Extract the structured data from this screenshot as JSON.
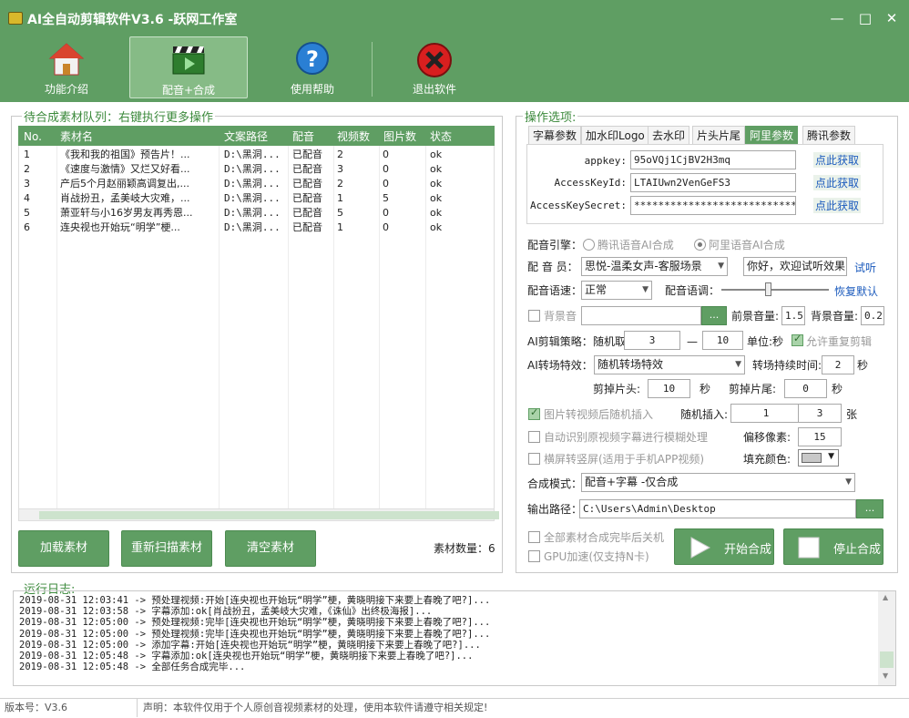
{
  "window": {
    "title": "AI全自动剪辑软件V3.6 -跃网工作室",
    "minimize": "—",
    "maximize": "□",
    "close": "✕"
  },
  "toolbar": [
    {
      "label": "功能介绍",
      "icon": "home-icon"
    },
    {
      "label": "配音+合成",
      "icon": "clapperboard-icon"
    },
    {
      "label": "使用帮助",
      "icon": "help-icon"
    },
    {
      "label": "退出软件",
      "icon": "exit-icon"
    }
  ],
  "queue": {
    "title": "待合成素材队列：右键执行更多操作",
    "columns": [
      "No.",
      "素材名",
      "文案路径",
      "配音",
      "视频数",
      "图片数",
      "状态"
    ],
    "rows": [
      [
        "1",
        "《我和我的祖国》预告片！...",
        "D:\\黑洞...",
        "已配音",
        "2",
        "0",
        "ok"
      ],
      [
        "2",
        "《速度与激情》又烂又好看...",
        "D:\\黑洞...",
        "已配音",
        "3",
        "0",
        "ok"
      ],
      [
        "3",
        "产后5个月赵丽颖高调复出,...",
        "D:\\黑洞...",
        "已配音",
        "2",
        "0",
        "ok"
      ],
      [
        "4",
        "肖战扮丑，孟美岐大灾难，...",
        "D:\\黑洞...",
        "已配音",
        "1",
        "5",
        "ok"
      ],
      [
        "5",
        "萧亚轩与小16岁男友再秀恩...",
        "D:\\黑洞...",
        "已配音",
        "5",
        "0",
        "ok"
      ],
      [
        "6",
        "连央视也开始玩“明学”梗...",
        "D:\\黑洞...",
        "已配音",
        "1",
        "0",
        "ok"
      ]
    ],
    "buttons": {
      "load": "加载素材",
      "rescan": "重新扫描素材",
      "clear": "清空素材"
    },
    "count_label": "素材数量：6"
  },
  "options": {
    "title": "操作选项:",
    "tabs": [
      "字幕参数",
      "加水印Logo",
      "去水印",
      "片头片尾",
      "阿里参数",
      "腾讯参数"
    ],
    "aliyun": {
      "appkey_label": "appkey:",
      "appkey_value": "95oVQj1CjBV2H3mq",
      "appkey_link": "点此获取",
      "akid_label": "AccessKeyId:",
      "akid_value": "LTAIUwn2VenGeFS3",
      "akid_link": "点此获取",
      "aksecret_label": "AccessKeySecret:",
      "aksecret_value": "******************************",
      "aksecret_link": "点此获取"
    },
    "engine_label": "配音引擎：",
    "engine_tencent": "腾讯语音AI合成",
    "engine_ali": "阿里语音AI合成",
    "voice_label": "配 音 员：",
    "voice_value": "思悦-温柔女声-客服场景",
    "voice_text": "你好，欢迎试听效果",
    "voice_try": "试听",
    "speed_label": "配音语速：",
    "speed_value": "正常",
    "pitch_label": "配音语调：",
    "pitch_reset": "恢复默认",
    "bgm_label": "背景音",
    "bgm_browse": "...",
    "fg_vol_label": "前景音量:",
    "fg_vol": "1.5",
    "bg_vol_label": "背景音量:",
    "bg_vol": "0.2",
    "strategy_label": "AI剪辑策略：",
    "random_label": "随机取:",
    "random_min": "3",
    "dash": "—",
    "random_max": "10",
    "unit_label": "单位:秒",
    "allow_repeat": "允许重复剪辑",
    "transition_label": "AI转场特效：",
    "transition_value": "随机转场特效",
    "transition_dur_label": "转场持续时间:",
    "transition_dur": "2",
    "sec": "秒",
    "cut_head_label": "剪掉片头:",
    "cut_head": "10",
    "cut_tail_label": "剪掉片尾:",
    "cut_tail": "0",
    "img_insert_label": "图片转视频后随机插入",
    "random_insert_label": "随机插入:",
    "insert_min": "1",
    "insert_max": "3",
    "zhang": "张",
    "blur_label": "自动识别原视频字幕进行模糊处理",
    "offset_label": "偏移像素:",
    "offset": "15",
    "portrait_label": "横屏转竖屏(适用于手机APP视频)",
    "fill_label": "填充颜色:",
    "mode_label": "合成模式：",
    "mode_value": "配音+字幕 -仅合成",
    "output_label": "输出路径：",
    "output_value": "C:\\Users\\Admin\\Desktop",
    "output_browse": "...",
    "shutdown_label": "全部素材合成完毕后关机",
    "gpu_label": "GPU加速(仅支持N卡)",
    "start": "开始合成",
    "stop": "停止合成"
  },
  "log": {
    "title": "运行日志:",
    "lines": [
      "2019-08-31 12:03:41 -> 预处理视频:开始[连央视也开始玩“明学”梗，黄晓明接下来要上春晚了吧?]...",
      "2019-08-31 12:03:58 -> 字幕添加:ok[肖战扮丑，孟美岐大灾难，《诛仙》出终极海报]...",
      "2019-08-31 12:05:00 -> 预处理视频:完毕[连央视也开始玩“明学”梗，黄晓明接下来要上春晚了吧?]...",
      "2019-08-31 12:05:00 -> 预处理视频:完毕[连央视也开始玩“明学”梗，黄晓明接下来要上春晚了吧?]...",
      "2019-08-31 12:05:00 -> 添加字幕:开始[连央视也开始玩“明学”梗，黄晓明接下来要上春晚了吧?]...",
      "2019-08-31 12:05:48 -> 字幕添加:ok[连央视也开始玩“明学”梗，黄晓明接下来要上春晚了吧?]...",
      "2019-08-31 12:05:48 -> 全部任务合成完毕..."
    ]
  },
  "status": {
    "version": "版本号：V3.6",
    "notice": "声明：本软件仅用于个人原创音视频素材的处理，使用本软件请遵守相关规定!"
  }
}
